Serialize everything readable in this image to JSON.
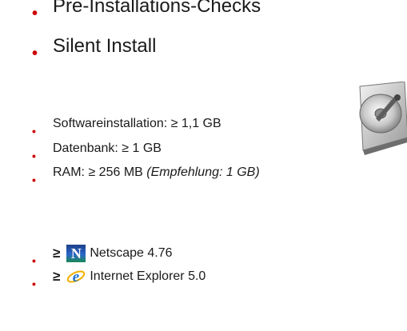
{
  "bullet_glyph": "•",
  "items_large": [
    {
      "text": "Pre-Installations-Checks"
    },
    {
      "text": "Silent Install"
    }
  ],
  "requirements": [
    {
      "text": "Softwareinstallation: ≥ 1,1 GB",
      "note": ""
    },
    {
      "text": "Datenbank: ≥ 1 GB",
      "note": ""
    },
    {
      "text": "RAM:  ≥ 256 MB ",
      "note": "(Empfehlung: 1 GB)"
    }
  ],
  "browsers": [
    {
      "ge": "≥",
      "icon": "netscape-icon",
      "label": "Netscape 4.76"
    },
    {
      "ge": "≥",
      "icon": "internet-explorer-icon",
      "label": "Internet Explorer 5.0"
    }
  ],
  "colors": {
    "bullet": "#cc0000",
    "text": "#1a1a1a"
  },
  "images": {
    "hard_drive": "hard-drive-icon"
  }
}
